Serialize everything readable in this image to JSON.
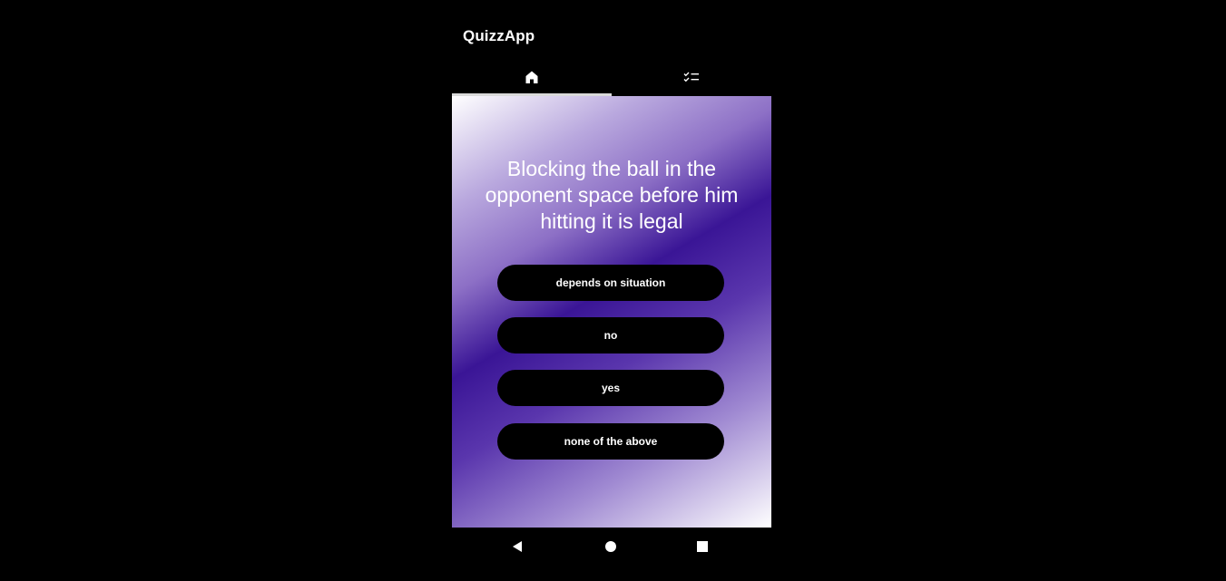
{
  "app": {
    "title": "QuizzApp"
  },
  "tabs": [
    {
      "icon": "home-icon",
      "selected": true
    },
    {
      "icon": "checklist-icon",
      "selected": false
    }
  ],
  "quiz": {
    "question": "Blocking the ball in the opponent space before him hitting it is legal",
    "answers": [
      "depends on situation",
      "no",
      "yes",
      "none of the above"
    ]
  },
  "nav_bar": {
    "buttons": [
      "back-icon",
      "home-circle-icon",
      "recents-icon"
    ]
  },
  "colors": {
    "background": "#000000",
    "gradient_dark": "#3a1596",
    "gradient_light": "#ffffff",
    "button": "#000000",
    "text": "#ffffff"
  }
}
